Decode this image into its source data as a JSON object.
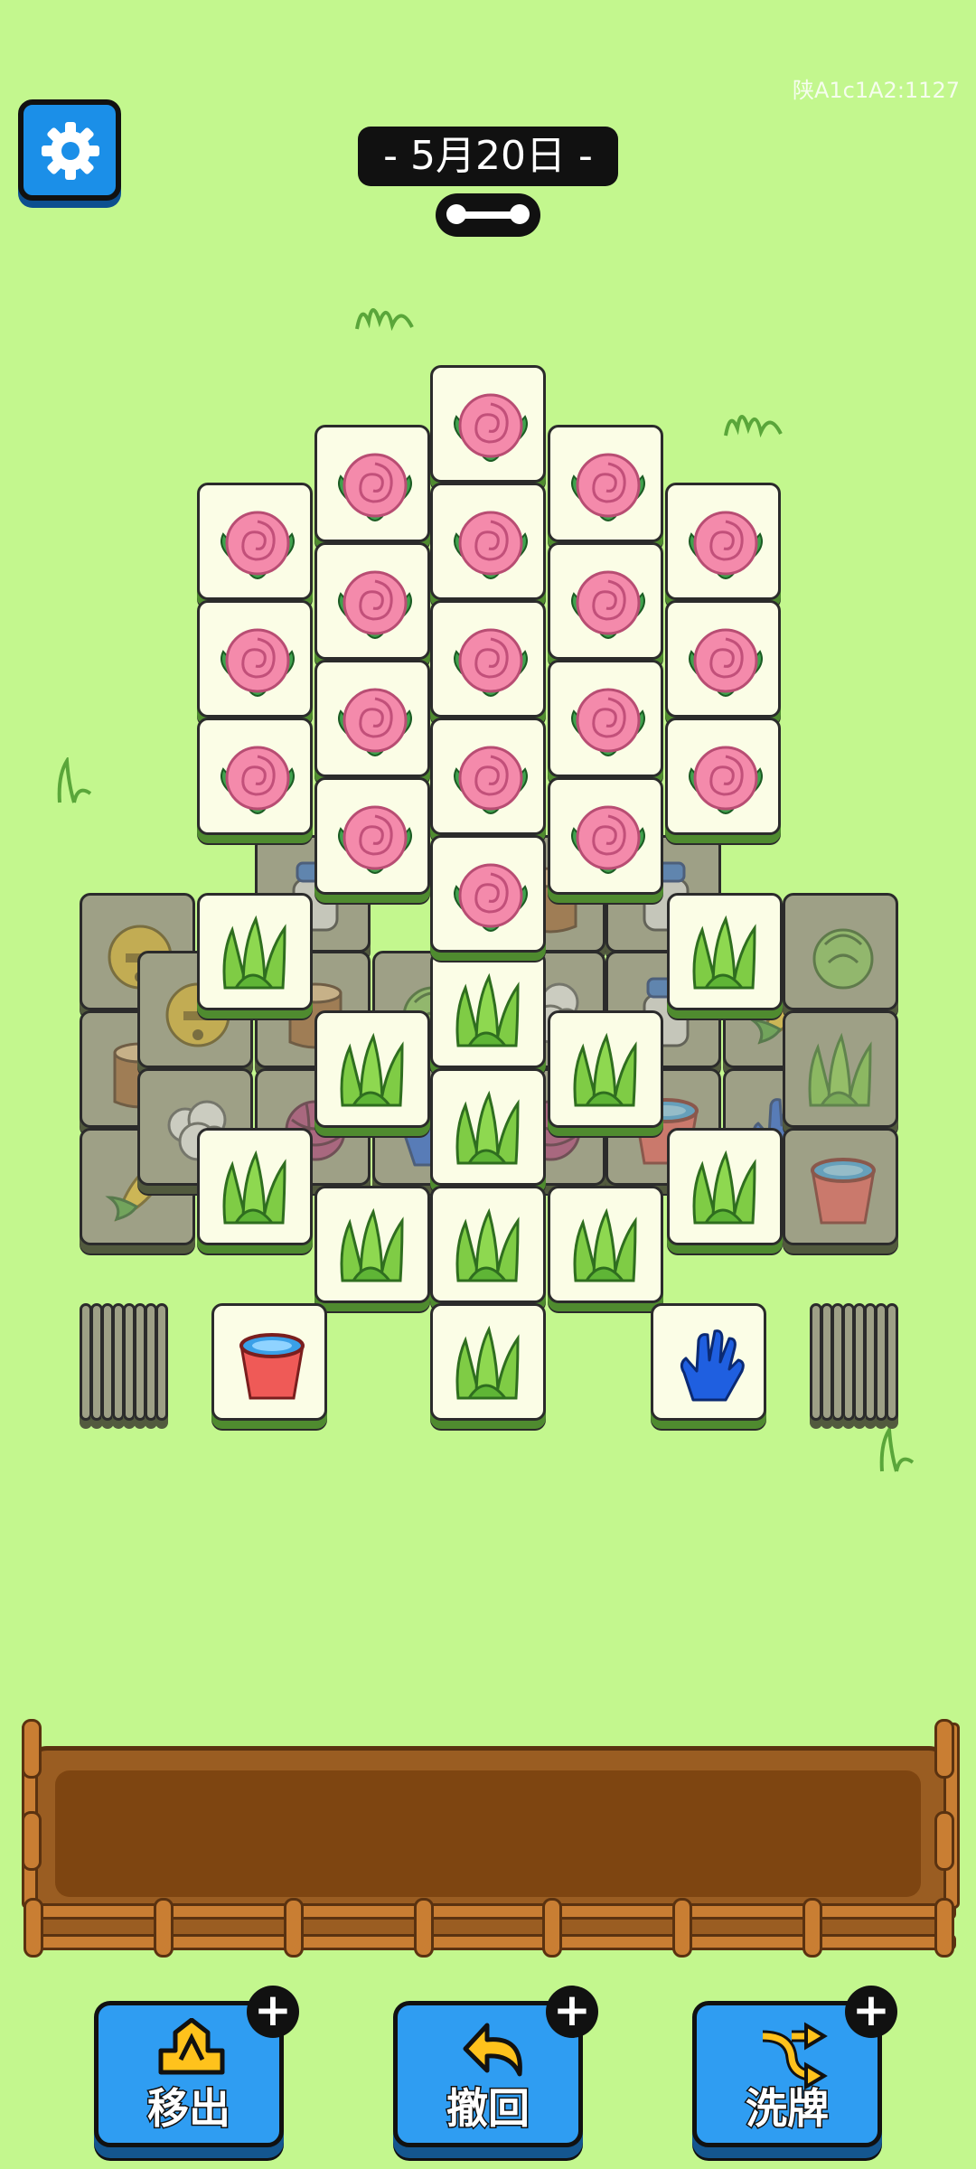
{
  "header": {
    "date_label": "- 5月20日 -",
    "version_text": "陕A1c1A2:1127"
  },
  "icons": {
    "settings": "gear-icon",
    "progress": "progress-dumbbell-icon",
    "tiles": [
      "rose-icon",
      "grass-icon",
      "bucket-icon",
      "glove-icon",
      "bell-icon",
      "stump-icon",
      "corn-icon",
      "cabbage-icon",
      "jar-icon",
      "yarn-icon"
    ]
  },
  "board": {
    "stack_left_top": "bucket",
    "stack_center_top": "grass",
    "stack_right_top": "glove"
  },
  "powerups": [
    {
      "label": "移出",
      "icon": "move-out-icon",
      "plus": "+"
    },
    {
      "label": "撤回",
      "icon": "undo-icon",
      "plus": "+"
    },
    {
      "label": "洗牌",
      "icon": "shuffle-icon",
      "plus": "+"
    }
  ],
  "colors": {
    "background": "#c3f78e",
    "button_blue": "#2f9df2",
    "tray_wood": "#9a5d22"
  }
}
